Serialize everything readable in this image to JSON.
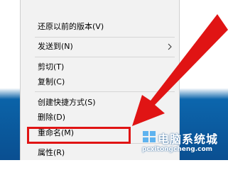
{
  "context_menu": {
    "items": [
      {
        "label": "还原以前的版本(V)"
      },
      {
        "label": "发送到(N)",
        "has_submenu": true
      },
      {
        "label": "剪切(T)"
      },
      {
        "label": "复制(C)"
      },
      {
        "label": "创建快捷方式(S)"
      },
      {
        "label": "删除(D)"
      },
      {
        "label": "重命名(M)",
        "highlighted": true
      },
      {
        "label": "属性(R)"
      }
    ]
  },
  "watermark": {
    "title": "电脑系统城",
    "url": "pcxitongcheng.com"
  },
  "colors": {
    "menu_bg": "#f2f2f2",
    "highlight_border": "#e01414",
    "arrow": "#e01414",
    "desktop": "#0b63a8"
  }
}
